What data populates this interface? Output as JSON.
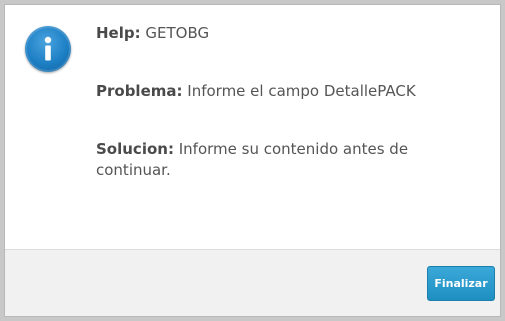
{
  "help": {
    "label": "Help:",
    "value": "GETOBG"
  },
  "problema": {
    "label": "Problema:",
    "value": "Informe el campo DetallePACK"
  },
  "solucion": {
    "label": "Solucion:",
    "value": "Informe su contenido antes de continuar."
  },
  "footer": {
    "finalizar_label": "Finalizar"
  },
  "icon": {
    "name": "info-icon",
    "color": "#1d7fc4"
  },
  "colors": {
    "accent": "#2a9bd0",
    "footer_bg": "#f1f1f1"
  }
}
